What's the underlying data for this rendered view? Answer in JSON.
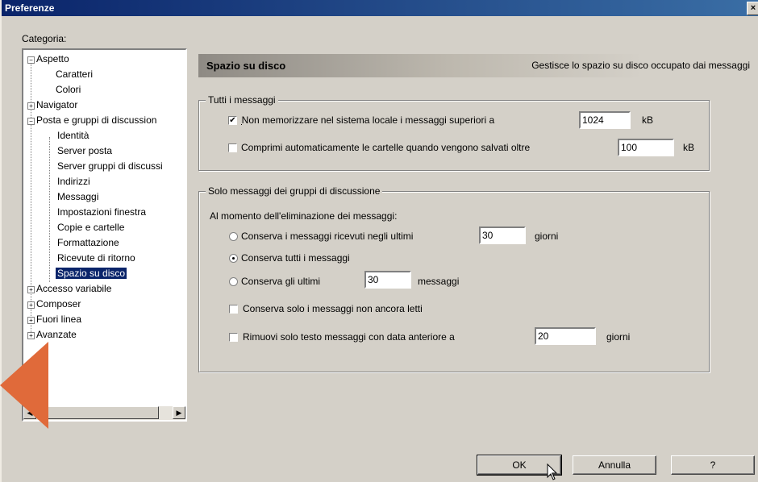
{
  "window": {
    "title": "Preferenze",
    "close": "×"
  },
  "category_label": "Categoria:",
  "tree": [
    {
      "label": "Aspetto",
      "level": 0,
      "expander": "−"
    },
    {
      "label": "Caratteri",
      "level": 1
    },
    {
      "label": "Colori",
      "level": 1
    },
    {
      "label": "Navigator",
      "level": 0,
      "expander": "+"
    },
    {
      "label": "Posta e gruppi di discussion",
      "level": 0,
      "expander": "−"
    },
    {
      "label": "Identità",
      "level": 1
    },
    {
      "label": "Server posta",
      "level": 1
    },
    {
      "label": "Server gruppi di discussi",
      "level": 1
    },
    {
      "label": "Indirizzi",
      "level": 1
    },
    {
      "label": "Messaggi",
      "level": 1
    },
    {
      "label": "Impostazioni finestra",
      "level": 1
    },
    {
      "label": "Copie e cartelle",
      "level": 1
    },
    {
      "label": "Formattazione",
      "level": 1
    },
    {
      "label": "Ricevute di ritorno",
      "level": 1
    },
    {
      "label": "Spazio su disco",
      "level": 1,
      "selected": true
    },
    {
      "label": "Accesso variabile",
      "level": 0,
      "expander": "+"
    },
    {
      "label": "Composer",
      "level": 0,
      "expander": "+"
    },
    {
      "label": "Fuori linea",
      "level": 0,
      "expander": "+"
    },
    {
      "label": "Avanzate",
      "level": 0,
      "expander": "+"
    }
  ],
  "header": {
    "title": "Spazio su disco",
    "description": "Gestisce lo spazio su disco occupato dai messaggi"
  },
  "group_all": {
    "title": "Tutti i messaggi",
    "no_store_label": "Non memorizzare nel sistema locale i messaggi superiori a",
    "no_store_checked": "✔",
    "no_store_value": "1024",
    "no_store_unit": "kB",
    "compress_label": "Comprimi automaticamente le cartelle quando vengono salvati oltre",
    "compress_value": "100",
    "compress_unit": "kB"
  },
  "group_news": {
    "title": "Solo messaggi dei gruppi di discussione",
    "intro": "Al momento dell'eliminazione dei messaggi:",
    "keep_days_label": "Conserva i messaggi ricevuti negli ultimi",
    "keep_days_value": "30",
    "keep_days_unit": "giorni",
    "keep_all_label": "Conserva tutti i messaggi",
    "keep_last_label": "Conserva gli ultimi",
    "keep_last_value": "30",
    "keep_last_unit": "messaggi",
    "unread_label": "Conserva solo i messaggi non ancora letti",
    "remove_body_label": "Rimuovi solo testo messaggi con data anteriore a",
    "remove_body_value": "20",
    "remove_body_unit": "giorni"
  },
  "buttons": {
    "ok": "OK",
    "cancel": "Annulla",
    "help": "?"
  },
  "colors": {
    "titlebar": "#0a246a",
    "window": "#d4d0c8",
    "arrow": "#e06a3a"
  }
}
